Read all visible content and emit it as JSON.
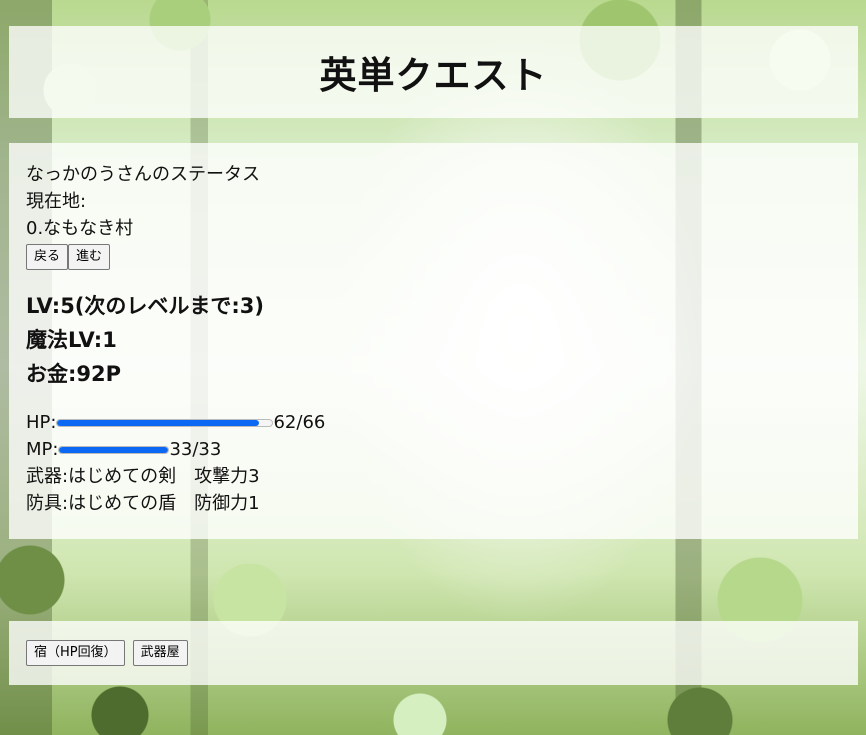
{
  "header": {
    "title": "英単クエスト"
  },
  "status": {
    "heading": "なっかのうさんのステータス",
    "location_label": "現在地:",
    "location_value": "0.なもなき村",
    "back_label": "戻る",
    "forward_label": "進む",
    "level": "LV:5(次のレベルまで:3)",
    "magic_level": "魔法LV:1",
    "money": "お金:92P",
    "hp": {
      "label": "HP:",
      "current": 62,
      "max": 66,
      "text": "62/66"
    },
    "mp": {
      "label": "MP:",
      "current": 33,
      "max": 33,
      "text": "33/33"
    },
    "weapon": "武器:はじめての剣　攻撃力3",
    "armor": "防具:はじめての盾　防御力1"
  },
  "shops": {
    "inn_label": "宿（HP回復）",
    "weapon_shop_label": "武器屋"
  },
  "colors": {
    "bar_fill": "#0a68f2",
    "panel_bg": "rgba(255,255,255,0.78)"
  }
}
